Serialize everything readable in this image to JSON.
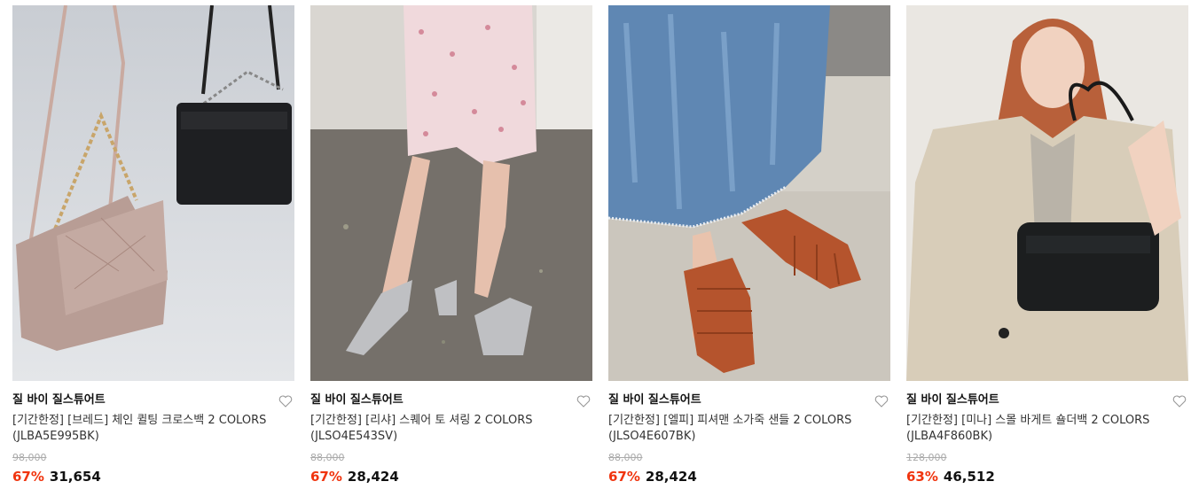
{
  "products": [
    {
      "brand": "질 바이 질스튜어트",
      "name_line1": "[기간한정] [브레드] 체인 퀼팅 크로스백 2 COLORS",
      "name_line2": "(JLBA5E995BK)",
      "original_price": "98,000",
      "discount": "67%",
      "price": "31,654",
      "image_icon": "handbag-photo"
    },
    {
      "brand": "질 바이 질스튜어트",
      "name_line1": "[기간한정] [리샤] 스퀘어 토 셔링 2 COLORS",
      "name_line2": "(JLSO4E543SV)",
      "original_price": "88,000",
      "discount": "67%",
      "price": "28,424",
      "image_icon": "sandal-photo"
    },
    {
      "brand": "질 바이 질스튜어트",
      "name_line1": "[기간한정] [엘피] 피셔맨 소가죽 샌들 2 COLORS",
      "name_line2": "(JLSO4E607BK)",
      "original_price": "88,000",
      "discount": "67%",
      "price": "28,424",
      "image_icon": "fisherman-sandal-photo"
    },
    {
      "brand": "질 바이 질스튜어트",
      "name_line1": "[기간한정] [미나] 스몰 바게트 숄더백 2 COLORS",
      "name_line2": "(JLBA4F860BK)",
      "original_price": "128,000",
      "discount": "63%",
      "price": "46,512",
      "image_icon": "shoulder-bag-photo"
    }
  ],
  "colors": {
    "discount": "#f0340e",
    "strike": "#aaaaaa",
    "brand": "#111111"
  }
}
